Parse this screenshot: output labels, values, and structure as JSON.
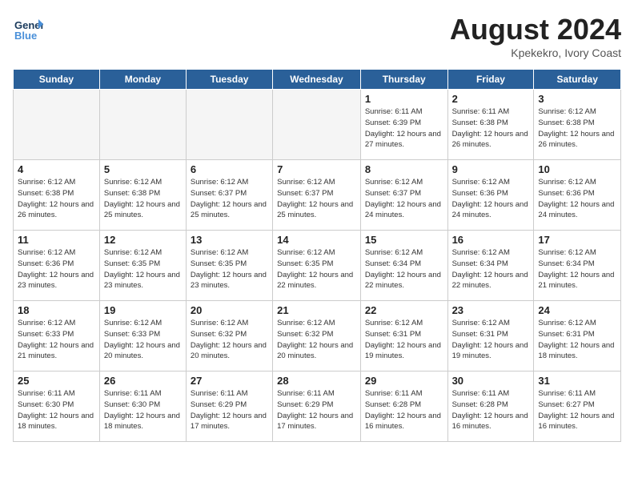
{
  "header": {
    "logo_general": "General",
    "logo_blue": "Blue",
    "month_year": "August 2024",
    "location": "Kpekekro, Ivory Coast"
  },
  "days_of_week": [
    "Sunday",
    "Monday",
    "Tuesday",
    "Wednesday",
    "Thursday",
    "Friday",
    "Saturday"
  ],
  "weeks": [
    [
      {
        "day": "",
        "sunrise": "",
        "sunset": "",
        "daylight": ""
      },
      {
        "day": "",
        "sunrise": "",
        "sunset": "",
        "daylight": ""
      },
      {
        "day": "",
        "sunrise": "",
        "sunset": "",
        "daylight": ""
      },
      {
        "day": "",
        "sunrise": "",
        "sunset": "",
        "daylight": ""
      },
      {
        "day": "1",
        "sunrise": "Sunrise: 6:11 AM",
        "sunset": "Sunset: 6:39 PM",
        "daylight": "Daylight: 12 hours and 27 minutes."
      },
      {
        "day": "2",
        "sunrise": "Sunrise: 6:11 AM",
        "sunset": "Sunset: 6:38 PM",
        "daylight": "Daylight: 12 hours and 26 minutes."
      },
      {
        "day": "3",
        "sunrise": "Sunrise: 6:12 AM",
        "sunset": "Sunset: 6:38 PM",
        "daylight": "Daylight: 12 hours and 26 minutes."
      }
    ],
    [
      {
        "day": "4",
        "sunrise": "Sunrise: 6:12 AM",
        "sunset": "Sunset: 6:38 PM",
        "daylight": "Daylight: 12 hours and 26 minutes."
      },
      {
        "day": "5",
        "sunrise": "Sunrise: 6:12 AM",
        "sunset": "Sunset: 6:38 PM",
        "daylight": "Daylight: 12 hours and 25 minutes."
      },
      {
        "day": "6",
        "sunrise": "Sunrise: 6:12 AM",
        "sunset": "Sunset: 6:37 PM",
        "daylight": "Daylight: 12 hours and 25 minutes."
      },
      {
        "day": "7",
        "sunrise": "Sunrise: 6:12 AM",
        "sunset": "Sunset: 6:37 PM",
        "daylight": "Daylight: 12 hours and 25 minutes."
      },
      {
        "day": "8",
        "sunrise": "Sunrise: 6:12 AM",
        "sunset": "Sunset: 6:37 PM",
        "daylight": "Daylight: 12 hours and 24 minutes."
      },
      {
        "day": "9",
        "sunrise": "Sunrise: 6:12 AM",
        "sunset": "Sunset: 6:36 PM",
        "daylight": "Daylight: 12 hours and 24 minutes."
      },
      {
        "day": "10",
        "sunrise": "Sunrise: 6:12 AM",
        "sunset": "Sunset: 6:36 PM",
        "daylight": "Daylight: 12 hours and 24 minutes."
      }
    ],
    [
      {
        "day": "11",
        "sunrise": "Sunrise: 6:12 AM",
        "sunset": "Sunset: 6:36 PM",
        "daylight": "Daylight: 12 hours and 23 minutes."
      },
      {
        "day": "12",
        "sunrise": "Sunrise: 6:12 AM",
        "sunset": "Sunset: 6:35 PM",
        "daylight": "Daylight: 12 hours and 23 minutes."
      },
      {
        "day": "13",
        "sunrise": "Sunrise: 6:12 AM",
        "sunset": "Sunset: 6:35 PM",
        "daylight": "Daylight: 12 hours and 23 minutes."
      },
      {
        "day": "14",
        "sunrise": "Sunrise: 6:12 AM",
        "sunset": "Sunset: 6:35 PM",
        "daylight": "Daylight: 12 hours and 22 minutes."
      },
      {
        "day": "15",
        "sunrise": "Sunrise: 6:12 AM",
        "sunset": "Sunset: 6:34 PM",
        "daylight": "Daylight: 12 hours and 22 minutes."
      },
      {
        "day": "16",
        "sunrise": "Sunrise: 6:12 AM",
        "sunset": "Sunset: 6:34 PM",
        "daylight": "Daylight: 12 hours and 22 minutes."
      },
      {
        "day": "17",
        "sunrise": "Sunrise: 6:12 AM",
        "sunset": "Sunset: 6:34 PM",
        "daylight": "Daylight: 12 hours and 21 minutes."
      }
    ],
    [
      {
        "day": "18",
        "sunrise": "Sunrise: 6:12 AM",
        "sunset": "Sunset: 6:33 PM",
        "daylight": "Daylight: 12 hours and 21 minutes."
      },
      {
        "day": "19",
        "sunrise": "Sunrise: 6:12 AM",
        "sunset": "Sunset: 6:33 PM",
        "daylight": "Daylight: 12 hours and 20 minutes."
      },
      {
        "day": "20",
        "sunrise": "Sunrise: 6:12 AM",
        "sunset": "Sunset: 6:32 PM",
        "daylight": "Daylight: 12 hours and 20 minutes."
      },
      {
        "day": "21",
        "sunrise": "Sunrise: 6:12 AM",
        "sunset": "Sunset: 6:32 PM",
        "daylight": "Daylight: 12 hours and 20 minutes."
      },
      {
        "day": "22",
        "sunrise": "Sunrise: 6:12 AM",
        "sunset": "Sunset: 6:31 PM",
        "daylight": "Daylight: 12 hours and 19 minutes."
      },
      {
        "day": "23",
        "sunrise": "Sunrise: 6:12 AM",
        "sunset": "Sunset: 6:31 PM",
        "daylight": "Daylight: 12 hours and 19 minutes."
      },
      {
        "day": "24",
        "sunrise": "Sunrise: 6:12 AM",
        "sunset": "Sunset: 6:31 PM",
        "daylight": "Daylight: 12 hours and 18 minutes."
      }
    ],
    [
      {
        "day": "25",
        "sunrise": "Sunrise: 6:11 AM",
        "sunset": "Sunset: 6:30 PM",
        "daylight": "Daylight: 12 hours and 18 minutes."
      },
      {
        "day": "26",
        "sunrise": "Sunrise: 6:11 AM",
        "sunset": "Sunset: 6:30 PM",
        "daylight": "Daylight: 12 hours and 18 minutes."
      },
      {
        "day": "27",
        "sunrise": "Sunrise: 6:11 AM",
        "sunset": "Sunset: 6:29 PM",
        "daylight": "Daylight: 12 hours and 17 minutes."
      },
      {
        "day": "28",
        "sunrise": "Sunrise: 6:11 AM",
        "sunset": "Sunset: 6:29 PM",
        "daylight": "Daylight: 12 hours and 17 minutes."
      },
      {
        "day": "29",
        "sunrise": "Sunrise: 6:11 AM",
        "sunset": "Sunset: 6:28 PM",
        "daylight": "Daylight: 12 hours and 16 minutes."
      },
      {
        "day": "30",
        "sunrise": "Sunrise: 6:11 AM",
        "sunset": "Sunset: 6:28 PM",
        "daylight": "Daylight: 12 hours and 16 minutes."
      },
      {
        "day": "31",
        "sunrise": "Sunrise: 6:11 AM",
        "sunset": "Sunset: 6:27 PM",
        "daylight": "Daylight: 12 hours and 16 minutes."
      }
    ]
  ]
}
